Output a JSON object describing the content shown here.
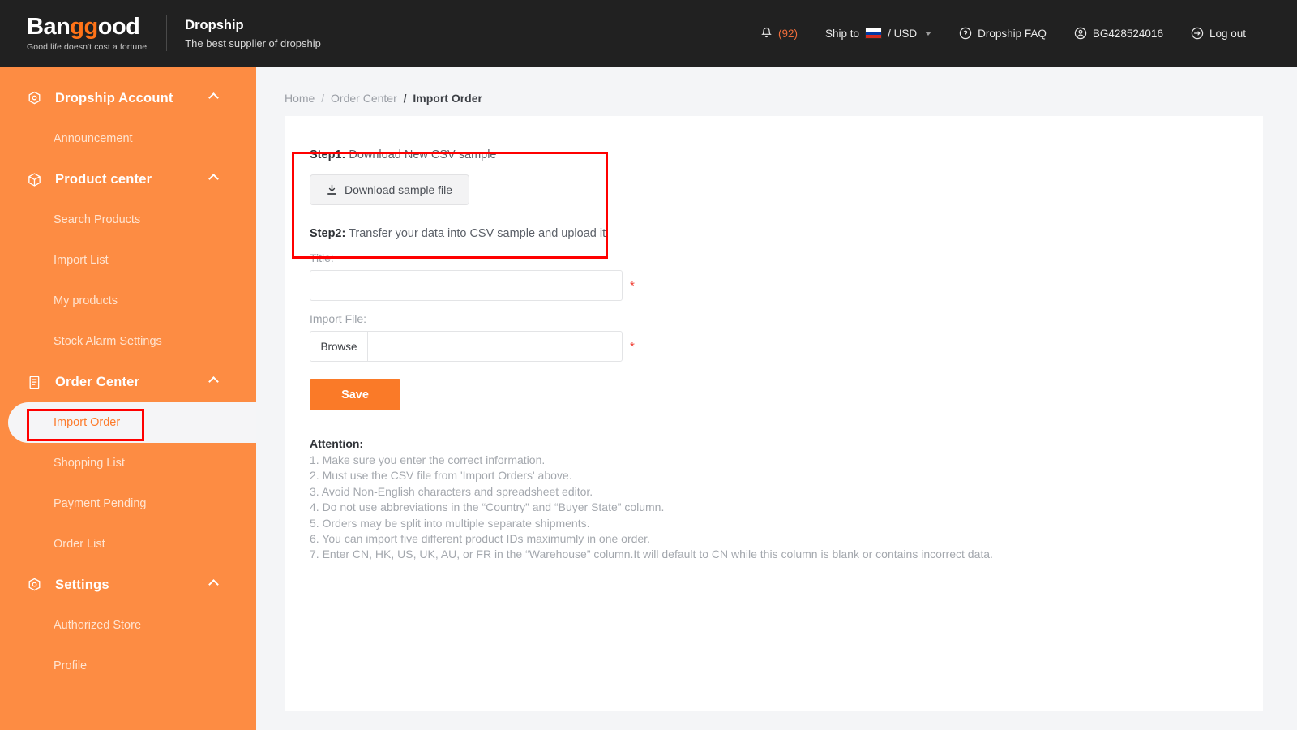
{
  "header": {
    "logo": {
      "text_part1": "Ban",
      "text_part2": "gg",
      "text_part3": "ood",
      "tagline": "Good life doesn't cost a fortune"
    },
    "brand": {
      "title": "Dropship",
      "subtitle": "The best supplier of dropship"
    },
    "right_items": [
      {
        "name": "notifications",
        "icon": "bell-icon",
        "count": "(92)"
      },
      {
        "name": "ship-to",
        "icon": "flag-ru-icon",
        "label": "Ship to",
        "currency": "/ USD"
      },
      {
        "name": "faq",
        "icon": "question-circle-icon",
        "label": "Dropship FAQ"
      },
      {
        "name": "account",
        "icon": "user-circle-icon",
        "label": "BG428524016"
      },
      {
        "name": "logout",
        "icon": "logout-icon",
        "label": "Log out"
      }
    ]
  },
  "sidebar": {
    "groups": [
      {
        "label": "Dropship Account",
        "icon": "gear-hex-icon",
        "items": [
          {
            "label": "Announcement",
            "active": false
          }
        ]
      },
      {
        "label": "Product center",
        "icon": "cube-icon",
        "items": [
          {
            "label": "Search Products",
            "active": false
          },
          {
            "label": "Import List",
            "active": false
          },
          {
            "label": "My products",
            "active": false
          },
          {
            "label": "Stock Alarm Settings",
            "active": false
          }
        ]
      },
      {
        "label": "Order Center",
        "icon": "document-list-icon",
        "items": [
          {
            "label": "Import Order",
            "active": true
          },
          {
            "label": "Shopping List",
            "active": false
          },
          {
            "label": "Payment Pending",
            "active": false
          },
          {
            "label": "Order List",
            "active": false
          }
        ]
      },
      {
        "label": "Settings",
        "icon": "gear-hex-icon",
        "items": [
          {
            "label": "Authorized Store",
            "active": false
          },
          {
            "label": "Profile",
            "active": false
          }
        ]
      }
    ]
  },
  "breadcrumb": {
    "home": "Home",
    "section": "Order Center",
    "current": "Import Order",
    "separator": "/"
  },
  "main": {
    "step1_label": "Step1:",
    "step1_text": " Download New CSV sample",
    "download_button": "Download sample file",
    "download_icon": "download-icon",
    "step2_label": "Step2:",
    "step2_text": " Transfer your data into CSV sample and upload it",
    "title_label": "Title:",
    "title_value": "",
    "title_placeholder": "",
    "required_mark": "*",
    "import_file_label": "Import File:",
    "browse_button": "Browse",
    "file_name_value": "",
    "save_button": "Save",
    "attention_title": "Attention:",
    "attention_items": [
      "1. Make sure you enter the correct information.",
      "2. Must use the CSV file from 'Import Orders' above.",
      "3. Avoid Non-English characters and spreadsheet editor.",
      "4. Do not use abbreviations in the “Country” and “Buyer State” column.",
      "5. Orders may be split into multiple separate shipments.",
      "6. You can import five different product IDs maximumly in one order.",
      "7. Enter CN, HK, US, UK, AU, or FR in the “Warehouse” column.It will default to CN while this column is blank or contains incorrect data."
    ]
  },
  "colors": {
    "header_bg": "#212121",
    "sidebar_bg": "#fd8c43",
    "accent_orange": "#fa7a28",
    "logo_orange": "#ff7318",
    "annotation_red": "#ff0000",
    "page_bg": "#f4f5f7",
    "card_bg": "#ffffff",
    "required_red": "#ef4136"
  }
}
